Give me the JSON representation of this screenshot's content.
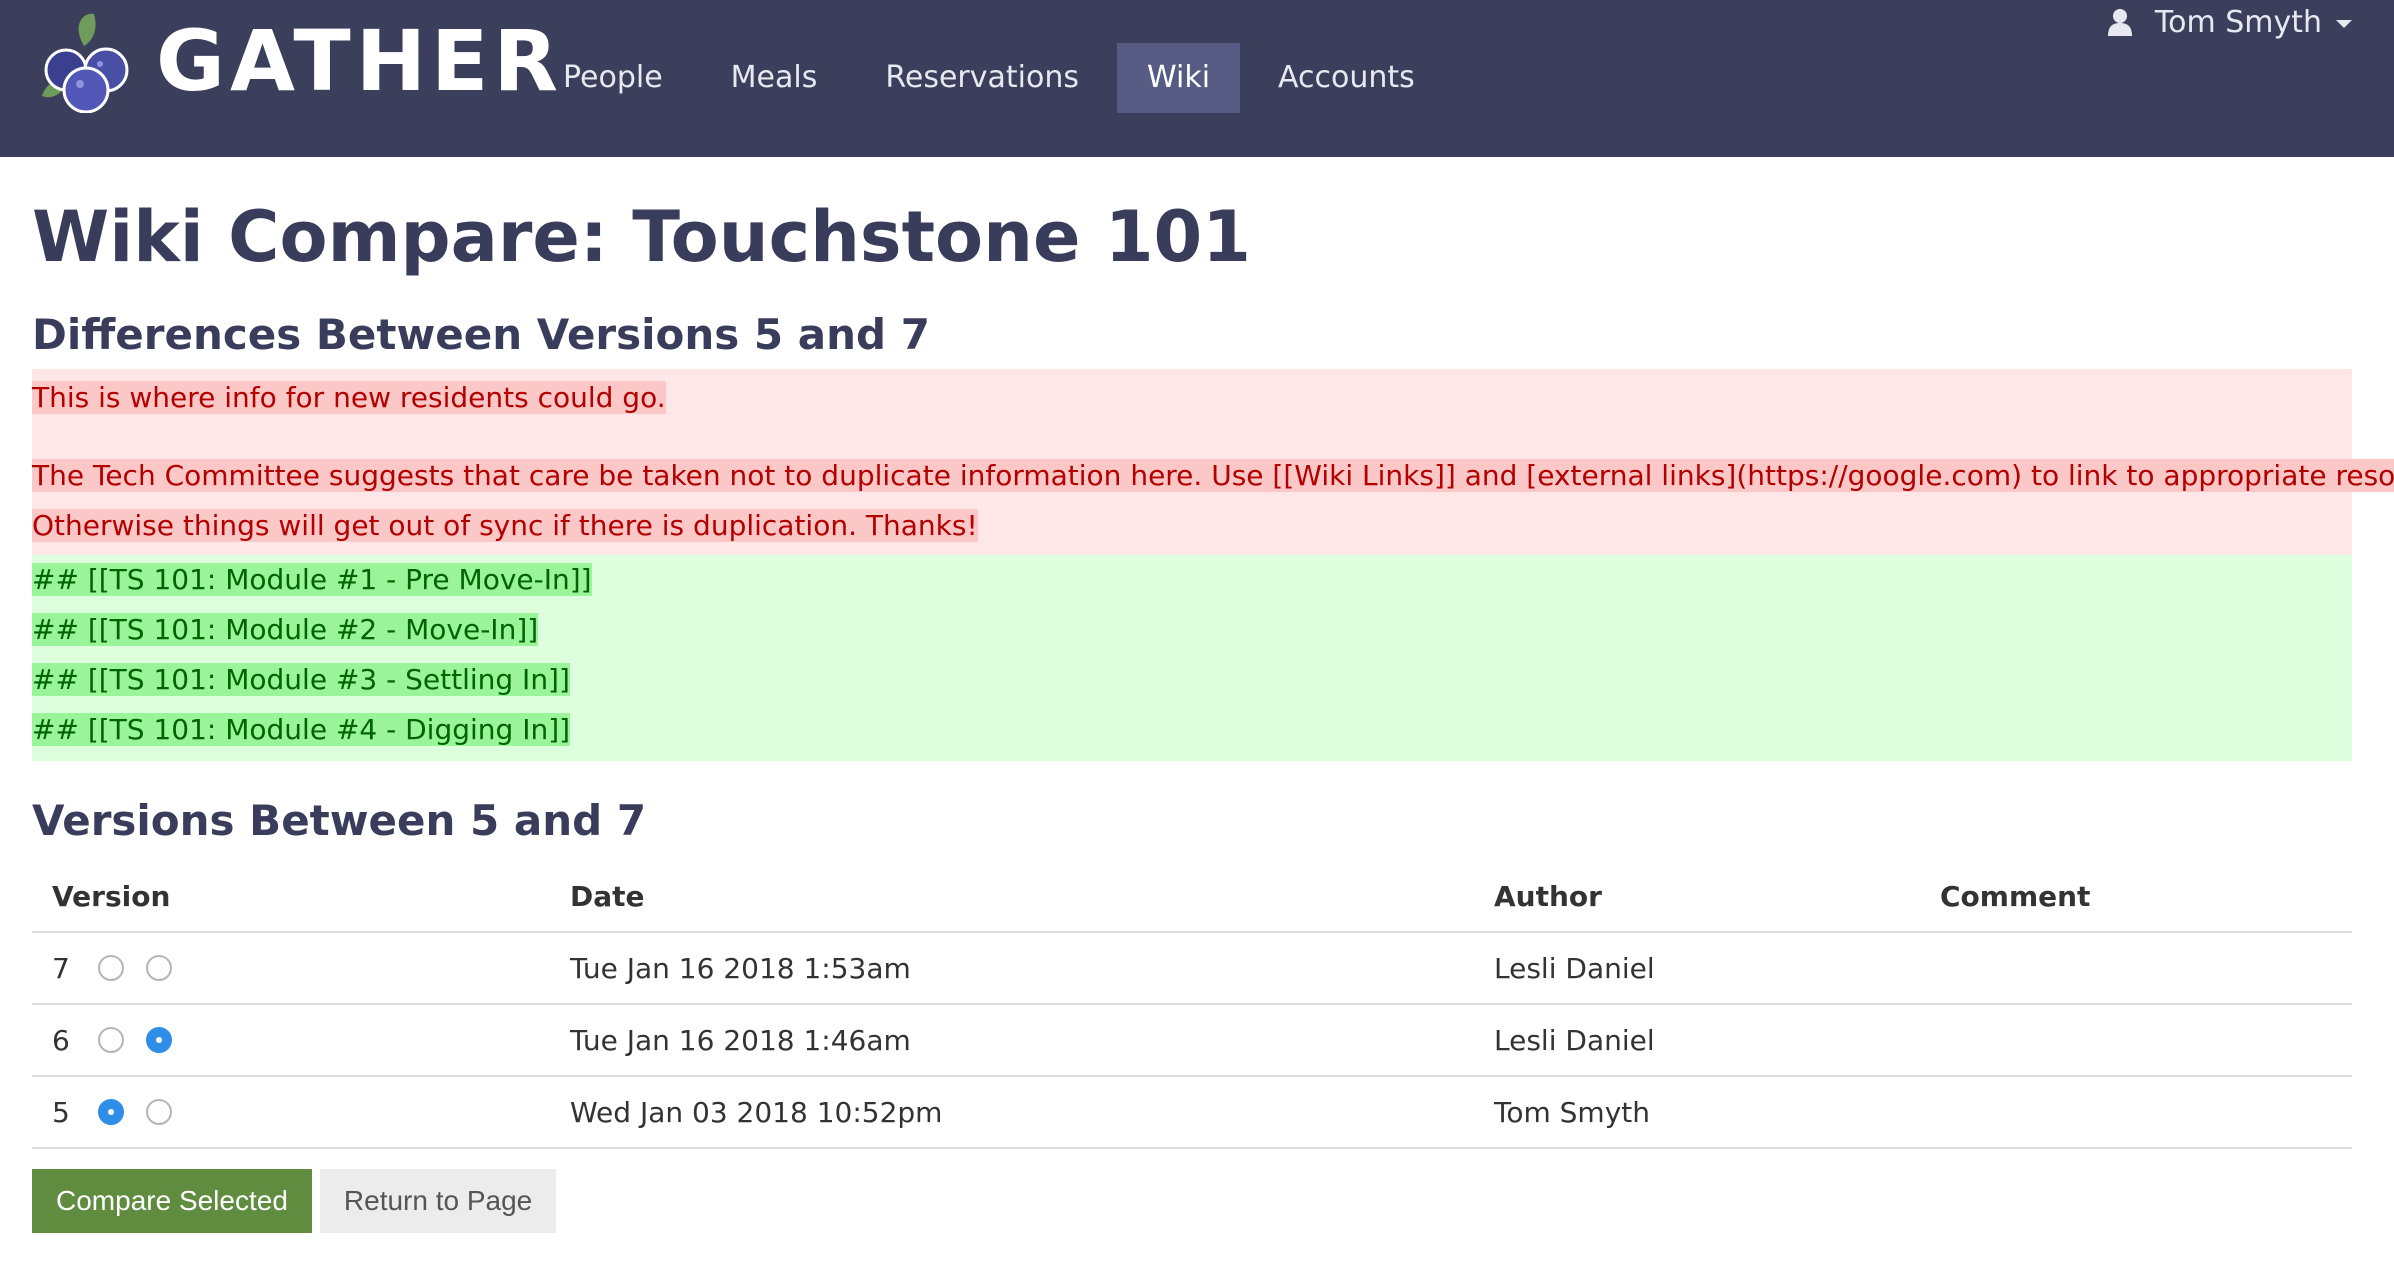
{
  "header": {
    "brand": "GATHER",
    "nav": [
      {
        "label": "People",
        "active": false
      },
      {
        "label": "Meals",
        "active": false
      },
      {
        "label": "Reservations",
        "active": false
      },
      {
        "label": "Wiki",
        "active": true
      },
      {
        "label": "Accounts",
        "active": false
      }
    ],
    "user": {
      "name": "Tom Smyth",
      "icon": "user-icon"
    }
  },
  "page": {
    "title": "Wiki Compare: Touchstone 101",
    "diff_heading": "Differences Between Versions 5 and 7",
    "diff": {
      "removed": [
        "This is where info for new residents could go.",
        "The Tech Committee suggests that care be taken not to duplicate information here. Use [[Wiki Links]] and [external links](https://google.com) to link to appropriate resources.",
        "Otherwise things will get out of sync if there is duplication. Thanks!"
      ],
      "added": [
        "## [[TS 101: Module #1 - Pre Move-In]]",
        "## [[TS 101: Module #2 - Move-In]]",
        "## [[TS 101: Module #3 - Settling In]]",
        "## [[TS 101: Module #4 - Digging In]]"
      ]
    },
    "versions_heading": "Versions Between 5 and 7",
    "table": {
      "columns": [
        "Version",
        "Date",
        "Author",
        "Comment"
      ],
      "rows": [
        {
          "version": "7",
          "old_selected": false,
          "new_selected": false,
          "date": "Tue Jan 16 2018 1:53am",
          "author": "Lesli Daniel",
          "comment": ""
        },
        {
          "version": "6",
          "old_selected": false,
          "new_selected": true,
          "date": "Tue Jan 16 2018 1:46am",
          "author": "Lesli Daniel",
          "comment": ""
        },
        {
          "version": "5",
          "old_selected": true,
          "new_selected": false,
          "date": "Wed Jan 03 2018 10:52pm",
          "author": "Tom Smyth",
          "comment": ""
        }
      ]
    },
    "buttons": {
      "compare": "Compare Selected",
      "return": "Return to Page"
    }
  },
  "colors": {
    "topbar": "#3b3f5c",
    "nav_active": "#575c85",
    "heading": "#393d5b",
    "removed_bg": "#ffe7e7",
    "removed_highlight": "#fcc7c7",
    "removed_text": "#b30000",
    "added_bg": "#ddffdd",
    "added_highlight": "#9af59a",
    "added_text": "#006400",
    "radio_checked": "#2f8ee8",
    "primary_button": "#5f8c3f"
  }
}
